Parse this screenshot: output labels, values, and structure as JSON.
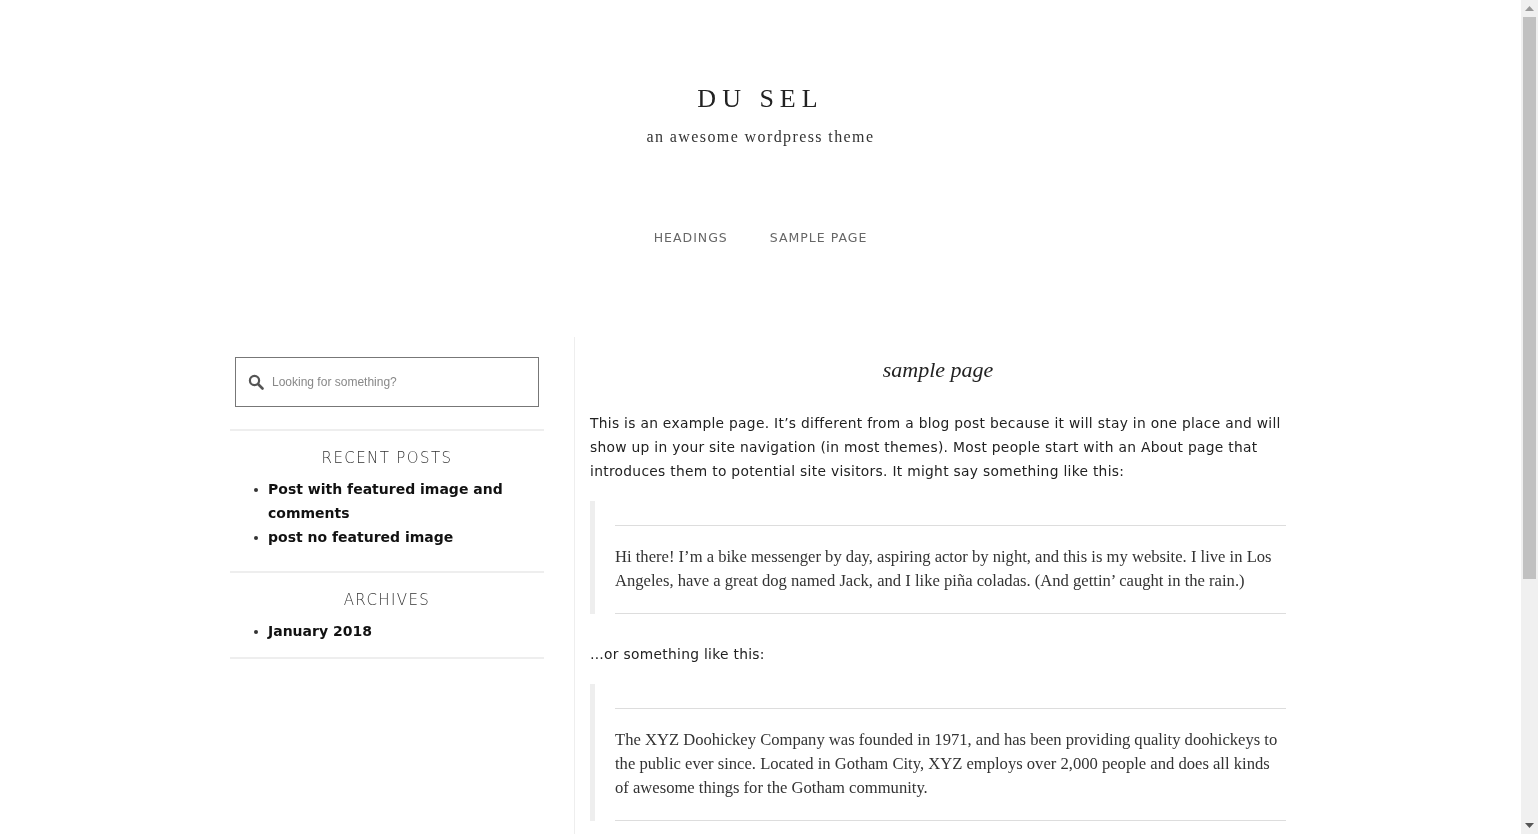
{
  "site": {
    "title": "DU SEL",
    "tagline": "an awesome wordpress theme"
  },
  "nav": [
    {
      "label": "HEADINGS"
    },
    {
      "label": "SAMPLE PAGE"
    }
  ],
  "sidebar": {
    "search": {
      "placeholder": "Looking for something?"
    },
    "widgets": [
      {
        "title": "RECENT POSTS",
        "items": [
          "Post with featured image and comments",
          "post no featured image"
        ]
      },
      {
        "title": "ARCHIVES",
        "items": [
          "January 2018"
        ]
      }
    ]
  },
  "page": {
    "title": "sample page",
    "content": [
      {
        "kind": "paragraph",
        "text": "This is an example page. It’s different from a blog post because it will stay in one place and will show up in your site navigation (in most themes). Most people start with an About page that introduces them to potential site visitors. It might say something like this:"
      },
      {
        "kind": "quote",
        "text": "Hi there! I’m a bike messenger by day, aspiring actor by night, and this is my website. I live in Los Angeles, have a great dog named Jack, and I like piña coladas. (And gettin’ caught in the rain.)"
      },
      {
        "kind": "paragraph",
        "text": "…or something like this:"
      },
      {
        "kind": "quote",
        "text": "The XYZ Doohickey Company was founded in 1971, and has been providing quality doohickeys to the public ever since. Located in Gotham City, XYZ employs over 2,000 people and does all kinds of awesome things for the Gotham community."
      }
    ]
  }
}
